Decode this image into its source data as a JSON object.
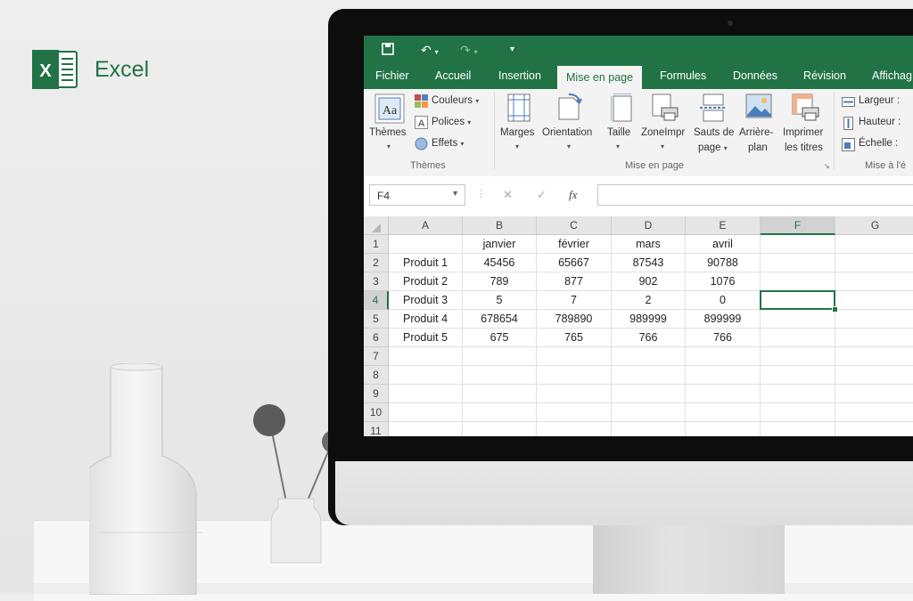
{
  "brand": {
    "text": "Excel",
    "color": "#217346",
    "icon": "excel-logo-icon",
    "icon_letter": "X"
  },
  "qat": {
    "save_icon": "save-icon",
    "undo_icon": "undo-icon",
    "redo_icon": "redo-icon",
    "customize_icon": "customize-icon"
  },
  "tabs": [
    {
      "label": "Fichier"
    },
    {
      "label": "Accueil"
    },
    {
      "label": "Insertion"
    },
    {
      "label": "Mise en page",
      "active": true
    },
    {
      "label": "Formules"
    },
    {
      "label": "Données"
    },
    {
      "label": "Révision"
    },
    {
      "label": "Affichag"
    }
  ],
  "ribbon": {
    "themes": {
      "label": "Thèmes",
      "group": "Thèmes",
      "colors": "Couleurs",
      "fonts": "Polices",
      "effects": "Effets"
    },
    "page_setup": {
      "group": "Mise en page",
      "margins": "Marges",
      "orientation": "Orientation",
      "size": "Taille",
      "print_area_1": "ZoneImpr",
      "breaks_1": "Sauts de",
      "breaks_2": "page",
      "background_1": "Arrière-",
      "background_2": "plan",
      "print_titles_1": "Imprimer",
      "print_titles_2": "les titres"
    },
    "scale": {
      "group": "Mise à l'é",
      "width": "Largeur :",
      "height": "Hauteur :",
      "scale": "Échelle :"
    }
  },
  "formula_bar": {
    "name_box": "F4",
    "cancel_icon": "✕",
    "enter_icon": "✓",
    "fx": "fx",
    "formula": ""
  },
  "grid": {
    "columns": [
      "A",
      "B",
      "C",
      "D",
      "E",
      "F",
      "G"
    ],
    "selected_column": "F",
    "rows": [
      "1",
      "2",
      "3",
      "4",
      "5",
      "6",
      "7",
      "8",
      "9",
      "10",
      "11"
    ],
    "selected_row": "4",
    "active_cell": "F4",
    "cells": [
      [
        "",
        "janvier",
        "février",
        "mars",
        "avril",
        "",
        ""
      ],
      [
        "Produit 1",
        "45456",
        "65667",
        "87543",
        "90788",
        "",
        ""
      ],
      [
        "Produit 2",
        "789",
        "877",
        "902",
        "1076",
        "",
        ""
      ],
      [
        "Produit 3",
        "5",
        "7",
        "2",
        "0",
        "",
        ""
      ],
      [
        "Produit 4",
        "678654",
        "789890",
        "989999",
        "899999",
        "",
        ""
      ],
      [
        "Produit 5",
        "675",
        "765",
        "766",
        "766",
        "",
        ""
      ],
      [
        "",
        "",
        "",
        "",
        "",
        "",
        ""
      ],
      [
        "",
        "",
        "",
        "",
        "",
        "",
        ""
      ],
      [
        "",
        "",
        "",
        "",
        "",
        "",
        ""
      ],
      [
        "",
        "",
        "",
        "",
        "",
        "",
        ""
      ],
      [
        "",
        "",
        "",
        "",
        "",
        "",
        ""
      ]
    ]
  },
  "colors": {
    "accent": "#217346",
    "ribbon_bg": "#f3f3f3",
    "header_bg": "#e6e6e6"
  }
}
